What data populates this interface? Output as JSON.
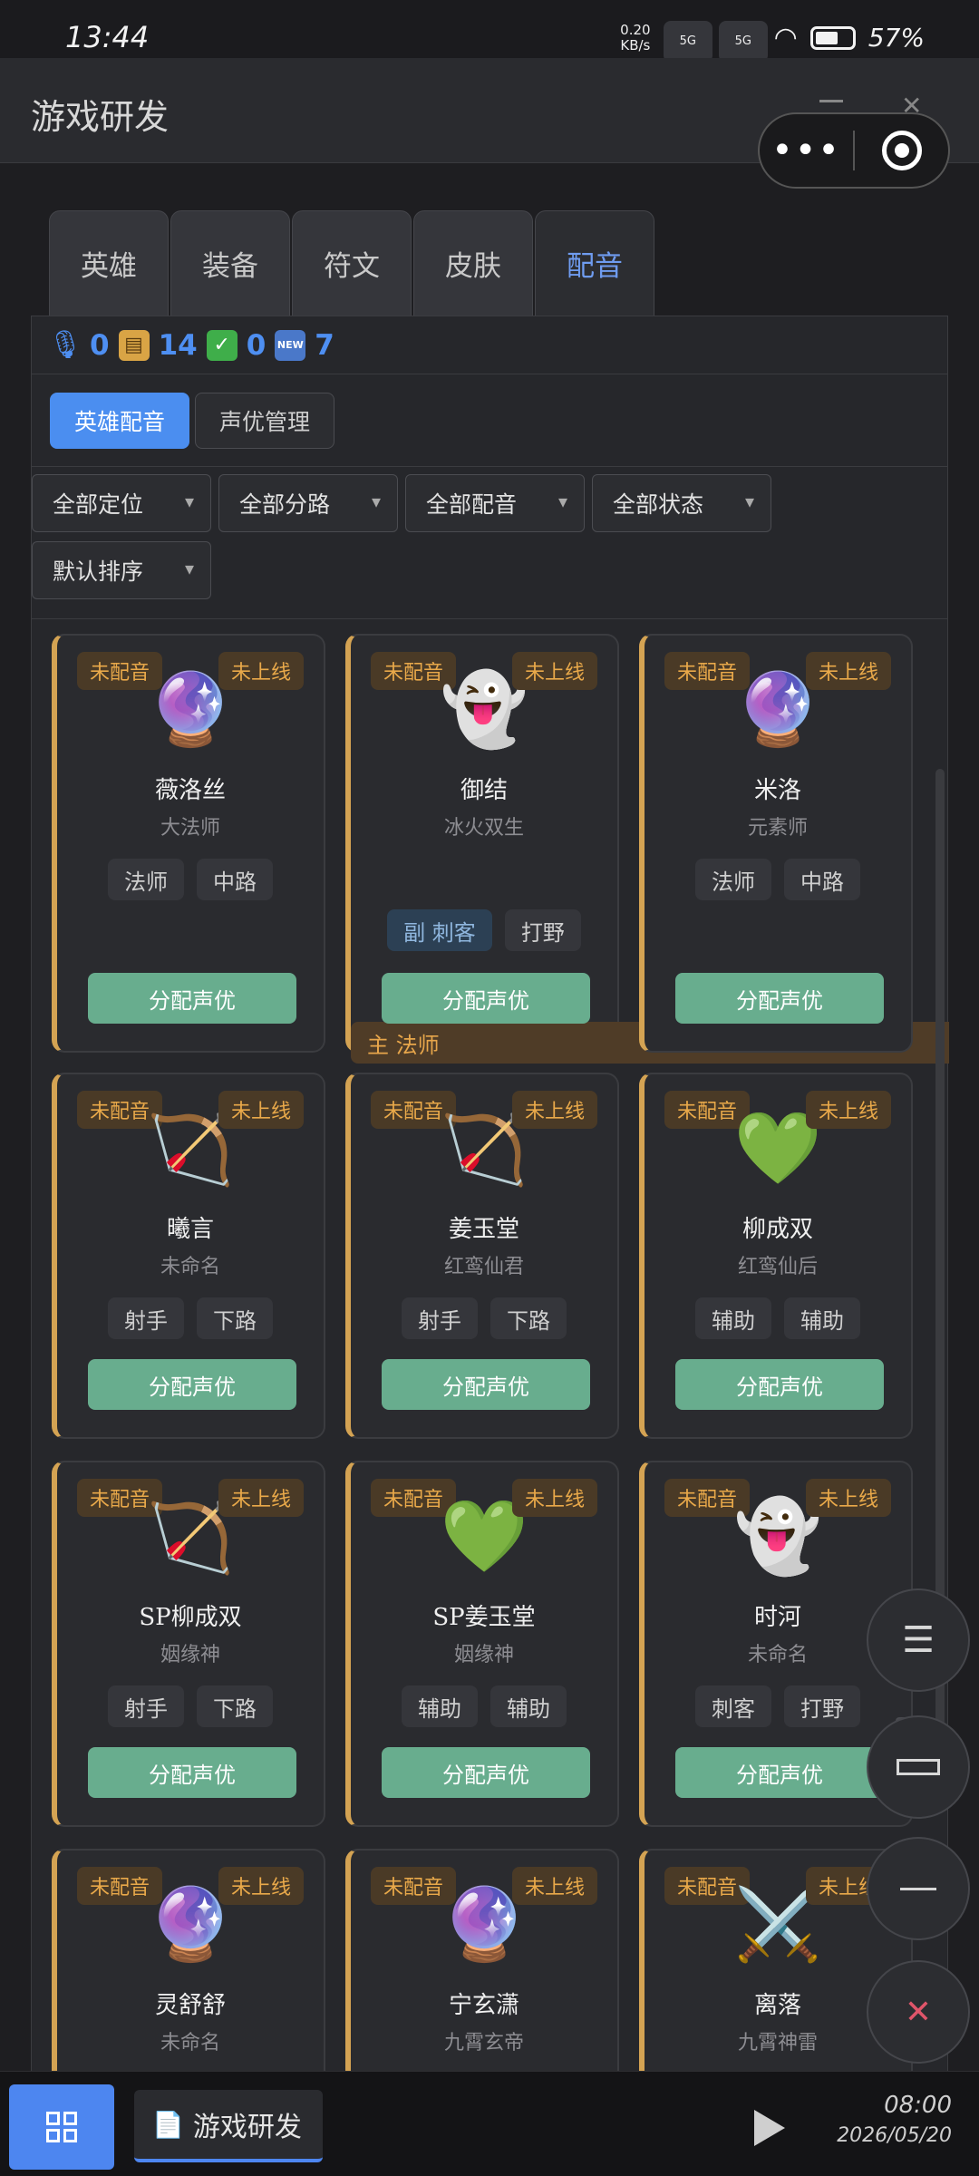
{
  "status_bar": {
    "time": "13:44",
    "net_speed_value": "0.20",
    "net_speed_unit": "KB/s",
    "sim1_label": "5G",
    "sim2_label": "5G",
    "wifi_label": "6",
    "battery_percent": "57%"
  },
  "app": {
    "title": "游戏研发",
    "capsule_more": "•••"
  },
  "tabs": [
    {
      "label": "英雄",
      "active": false
    },
    {
      "label": "装备",
      "active": false
    },
    {
      "label": "符文",
      "active": false
    },
    {
      "label": "皮肤",
      "active": false
    },
    {
      "label": "配音",
      "active": true
    }
  ],
  "stats": {
    "mic_count": "0",
    "clipboard_count": "14",
    "done_count": "0",
    "new_count": "7",
    "new_icon_text": "NEW"
  },
  "subtabs": [
    {
      "label": "英雄配音",
      "active": true
    },
    {
      "label": "声优管理",
      "active": false
    }
  ],
  "filters": {
    "role": "全部定位",
    "lane": "全部分路",
    "voice": "全部配音",
    "status": "全部状态",
    "sort": "默认排序"
  },
  "card_badges": {
    "voice_status": "未配音",
    "release_status": "未上线"
  },
  "assign_button_label": "分配声优",
  "heroes": [
    {
      "name": "薇洛丝",
      "title": "大法师",
      "avatar": "🔮",
      "tags": [
        "法师",
        "中路"
      ]
    },
    {
      "name": "御结",
      "title": "冰火双生",
      "avatar": "👻",
      "main_tag": "主 法师",
      "vice_tag": "副 刺客",
      "tags": [
        "打野"
      ]
    },
    {
      "name": "米洛",
      "title": "元素师",
      "avatar": "🔮",
      "tags": [
        "法师",
        "中路"
      ]
    },
    {
      "name": "曦言",
      "title": "未命名",
      "avatar": "🏹",
      "tags": [
        "射手",
        "下路"
      ]
    },
    {
      "name": "姜玉堂",
      "title": "红鸾仙君",
      "avatar": "🏹",
      "tags": [
        "射手",
        "下路"
      ]
    },
    {
      "name": "柳成双",
      "title": "红鸾仙后",
      "avatar": "💚",
      "tags": [
        "辅助",
        "辅助"
      ]
    },
    {
      "name": "SP柳成双",
      "title": "姻缘神",
      "avatar": "🏹",
      "tags": [
        "射手",
        "下路"
      ]
    },
    {
      "name": "SP姜玉堂",
      "title": "姻缘神",
      "avatar": "💚",
      "tags": [
        "辅助",
        "辅助"
      ]
    },
    {
      "name": "时河",
      "title": "未命名",
      "avatar": "👻",
      "tags": [
        "刺客",
        "打野"
      ]
    },
    {
      "name": "灵舒舒",
      "title": "未命名",
      "avatar": "🔮",
      "tags": []
    },
    {
      "name": "宁玄潇",
      "title": "九霄玄帝",
      "avatar": "🔮",
      "tags": []
    },
    {
      "name": "离落",
      "title": "九霄神雷",
      "avatar": "⚔️",
      "tags": []
    }
  ],
  "fabs": {
    "menu": "☰",
    "close": "✕"
  },
  "taskbar": {
    "task_label": "游戏研发",
    "clock_time": "08:00",
    "clock_date": "2026/05/20"
  },
  "colors": {
    "accent_blue": "#4b8ef0",
    "card_accent_gold": "#d4a353",
    "assign_green": "#68ad8e",
    "badge_orange": "#e9a94a"
  }
}
